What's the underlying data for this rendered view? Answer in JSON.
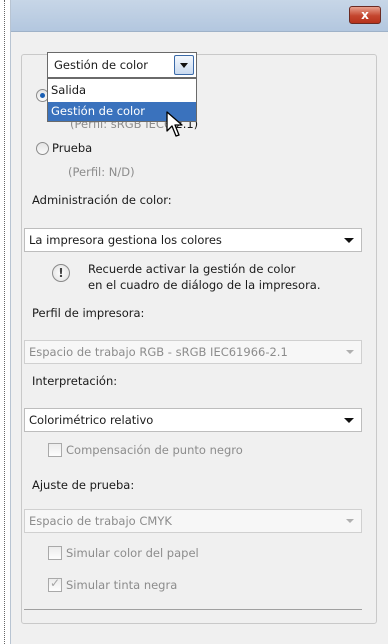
{
  "window": {
    "close_label": "x"
  },
  "dropdown": {
    "selected": "Gestión de color",
    "options": [
      "Salida",
      "Gestión de color"
    ]
  },
  "output": {
    "salida_label": "Salida",
    "salida_profile_partial": "(Perfil: sRGB IEC6",
    "salida_profile_end": "-2.1)",
    "prueba_label": "Prueba",
    "prueba_profile": "(Perfil: N/D)"
  },
  "color_management": {
    "label": "Administración de color:",
    "value": "La impresora gestiona los colores",
    "notice_line1": "Recuerde activar la gestión de color",
    "notice_line2": "en el cuadro de diálogo de la impresora."
  },
  "printer_profile": {
    "label": "Perfil de impresora:",
    "value": "Espacio de trabajo RGB - sRGB IEC61966-2.1"
  },
  "rendering": {
    "label": "Interpretación:",
    "value": "Colorimétrico relativo",
    "black_point_label": "Compensación de punto negro",
    "black_point_checked": false
  },
  "proof_setup": {
    "label": "Ajuste de prueba:",
    "value": "Espacio de trabajo CMYK",
    "paper_color_label": "Simular color del papel",
    "paper_color_checked": false,
    "black_ink_label": "Simular tinta negra",
    "black_ink_checked": true
  },
  "colors": {
    "highlight": "#3a72bd",
    "close_button": "#c4462f"
  }
}
